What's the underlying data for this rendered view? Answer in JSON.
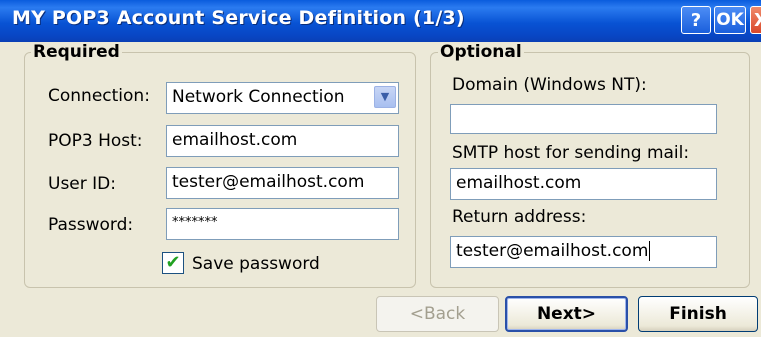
{
  "window": {
    "title": "MY POP3 Account Service Definition (1/3)",
    "help_label": "?",
    "ok_label": "OK",
    "close_label": "X"
  },
  "required": {
    "legend": "Required",
    "connection": {
      "label": "Connection:",
      "value": "Network Connection"
    },
    "pop3_host": {
      "label": "POP3 Host:",
      "value": "emailhost.com"
    },
    "user_id": {
      "label": "User ID:",
      "value": "tester@emailhost.com"
    },
    "password": {
      "label": "Password:",
      "value": "*******"
    },
    "save_password": {
      "label": "Save password",
      "checked": true,
      "check_mark": "✔"
    }
  },
  "optional": {
    "legend": "Optional",
    "domain": {
      "label": "Domain (Windows NT):",
      "value": ""
    },
    "smtp_host": {
      "label": "SMTP host for sending mail:",
      "value": "emailhost.com"
    },
    "return_address": {
      "label": "Return address:",
      "value": "tester@emailhost.com"
    }
  },
  "buttons": {
    "back": "<Back",
    "next": "Next>",
    "finish": "Finish"
  },
  "icons": {
    "dropdown": "chevron-down-icon",
    "check": "checkmark-icon"
  },
  "colors": {
    "title_bar": "#0853D4",
    "dialog_bg": "#ECE9D8",
    "field_border": "#7f9db9",
    "check_color": "#21a121"
  }
}
